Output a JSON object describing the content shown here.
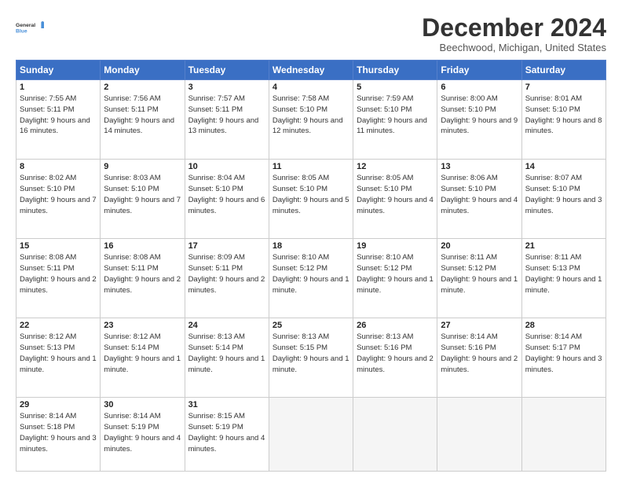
{
  "logo": {
    "line1": "General",
    "line2": "Blue"
  },
  "title": "December 2024",
  "location": "Beechwood, Michigan, United States",
  "days_of_week": [
    "Sunday",
    "Monday",
    "Tuesday",
    "Wednesday",
    "Thursday",
    "Friday",
    "Saturday"
  ],
  "weeks": [
    [
      {
        "day": "1",
        "info": "Sunrise: 7:55 AM\nSunset: 5:11 PM\nDaylight: 9 hours and 16 minutes."
      },
      {
        "day": "2",
        "info": "Sunrise: 7:56 AM\nSunset: 5:11 PM\nDaylight: 9 hours and 14 minutes."
      },
      {
        "day": "3",
        "info": "Sunrise: 7:57 AM\nSunset: 5:11 PM\nDaylight: 9 hours and 13 minutes."
      },
      {
        "day": "4",
        "info": "Sunrise: 7:58 AM\nSunset: 5:10 PM\nDaylight: 9 hours and 12 minutes."
      },
      {
        "day": "5",
        "info": "Sunrise: 7:59 AM\nSunset: 5:10 PM\nDaylight: 9 hours and 11 minutes."
      },
      {
        "day": "6",
        "info": "Sunrise: 8:00 AM\nSunset: 5:10 PM\nDaylight: 9 hours and 9 minutes."
      },
      {
        "day": "7",
        "info": "Sunrise: 8:01 AM\nSunset: 5:10 PM\nDaylight: 9 hours and 8 minutes."
      }
    ],
    [
      {
        "day": "8",
        "info": "Sunrise: 8:02 AM\nSunset: 5:10 PM\nDaylight: 9 hours and 7 minutes."
      },
      {
        "day": "9",
        "info": "Sunrise: 8:03 AM\nSunset: 5:10 PM\nDaylight: 9 hours and 7 minutes."
      },
      {
        "day": "10",
        "info": "Sunrise: 8:04 AM\nSunset: 5:10 PM\nDaylight: 9 hours and 6 minutes."
      },
      {
        "day": "11",
        "info": "Sunrise: 8:05 AM\nSunset: 5:10 PM\nDaylight: 9 hours and 5 minutes."
      },
      {
        "day": "12",
        "info": "Sunrise: 8:05 AM\nSunset: 5:10 PM\nDaylight: 9 hours and 4 minutes."
      },
      {
        "day": "13",
        "info": "Sunrise: 8:06 AM\nSunset: 5:10 PM\nDaylight: 9 hours and 4 minutes."
      },
      {
        "day": "14",
        "info": "Sunrise: 8:07 AM\nSunset: 5:10 PM\nDaylight: 9 hours and 3 minutes."
      }
    ],
    [
      {
        "day": "15",
        "info": "Sunrise: 8:08 AM\nSunset: 5:11 PM\nDaylight: 9 hours and 2 minutes."
      },
      {
        "day": "16",
        "info": "Sunrise: 8:08 AM\nSunset: 5:11 PM\nDaylight: 9 hours and 2 minutes."
      },
      {
        "day": "17",
        "info": "Sunrise: 8:09 AM\nSunset: 5:11 PM\nDaylight: 9 hours and 2 minutes."
      },
      {
        "day": "18",
        "info": "Sunrise: 8:10 AM\nSunset: 5:12 PM\nDaylight: 9 hours and 1 minute."
      },
      {
        "day": "19",
        "info": "Sunrise: 8:10 AM\nSunset: 5:12 PM\nDaylight: 9 hours and 1 minute."
      },
      {
        "day": "20",
        "info": "Sunrise: 8:11 AM\nSunset: 5:12 PM\nDaylight: 9 hours and 1 minute."
      },
      {
        "day": "21",
        "info": "Sunrise: 8:11 AM\nSunset: 5:13 PM\nDaylight: 9 hours and 1 minute."
      }
    ],
    [
      {
        "day": "22",
        "info": "Sunrise: 8:12 AM\nSunset: 5:13 PM\nDaylight: 9 hours and 1 minute."
      },
      {
        "day": "23",
        "info": "Sunrise: 8:12 AM\nSunset: 5:14 PM\nDaylight: 9 hours and 1 minute."
      },
      {
        "day": "24",
        "info": "Sunrise: 8:13 AM\nSunset: 5:14 PM\nDaylight: 9 hours and 1 minute."
      },
      {
        "day": "25",
        "info": "Sunrise: 8:13 AM\nSunset: 5:15 PM\nDaylight: 9 hours and 1 minute."
      },
      {
        "day": "26",
        "info": "Sunrise: 8:13 AM\nSunset: 5:16 PM\nDaylight: 9 hours and 2 minutes."
      },
      {
        "day": "27",
        "info": "Sunrise: 8:14 AM\nSunset: 5:16 PM\nDaylight: 9 hours and 2 minutes."
      },
      {
        "day": "28",
        "info": "Sunrise: 8:14 AM\nSunset: 5:17 PM\nDaylight: 9 hours and 3 minutes."
      }
    ],
    [
      {
        "day": "29",
        "info": "Sunrise: 8:14 AM\nSunset: 5:18 PM\nDaylight: 9 hours and 3 minutes."
      },
      {
        "day": "30",
        "info": "Sunrise: 8:14 AM\nSunset: 5:19 PM\nDaylight: 9 hours and 4 minutes."
      },
      {
        "day": "31",
        "info": "Sunrise: 8:15 AM\nSunset: 5:19 PM\nDaylight: 9 hours and 4 minutes."
      },
      {
        "day": "",
        "info": ""
      },
      {
        "day": "",
        "info": ""
      },
      {
        "day": "",
        "info": ""
      },
      {
        "day": "",
        "info": ""
      }
    ]
  ]
}
